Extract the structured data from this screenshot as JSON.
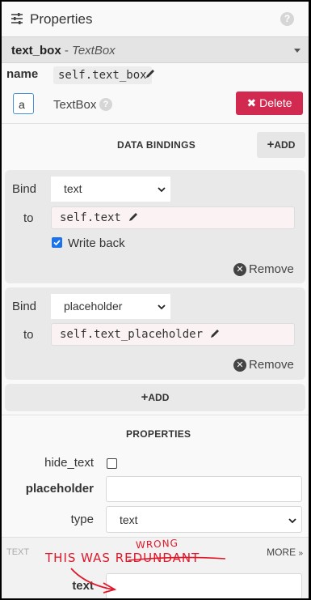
{
  "header": {
    "title": "Properties",
    "help": "?"
  },
  "component": {
    "name": "text_box",
    "separator": " - ",
    "type": "TextBox"
  },
  "name_row": {
    "label": "name",
    "value": "self.text_box"
  },
  "preview_row": {
    "preview_text": "a",
    "type_label": "TextBox",
    "help": "?",
    "delete_label": "Delete"
  },
  "data_bindings": {
    "title": "DATA BINDINGS",
    "add_label": "ADD",
    "bindings": [
      {
        "bind_label": "Bind",
        "property": "text",
        "to_label": "to",
        "expression": "self.text",
        "write_back_label": "Write back",
        "write_back": true,
        "remove_label": "Remove"
      },
      {
        "bind_label": "Bind",
        "property": "placeholder",
        "to_label": "to",
        "expression": "self.text_placeholder",
        "remove_label": "Remove"
      }
    ],
    "add_bottom_label": "ADD"
  },
  "properties": {
    "title": "PROPERTIES",
    "hide_text": {
      "label": "hide_text",
      "checked": false
    },
    "placeholder": {
      "label": "placeholder",
      "value": ""
    },
    "type": {
      "label": "type",
      "value": "text"
    }
  },
  "text_section": {
    "title": "TEXT",
    "more_label": "MORE",
    "text_field": {
      "label": "text",
      "value": ""
    }
  },
  "annotation": {
    "line": "THIS WAS REDUNDANT",
    "correction": "WRONG",
    "color": "#e0182b"
  }
}
